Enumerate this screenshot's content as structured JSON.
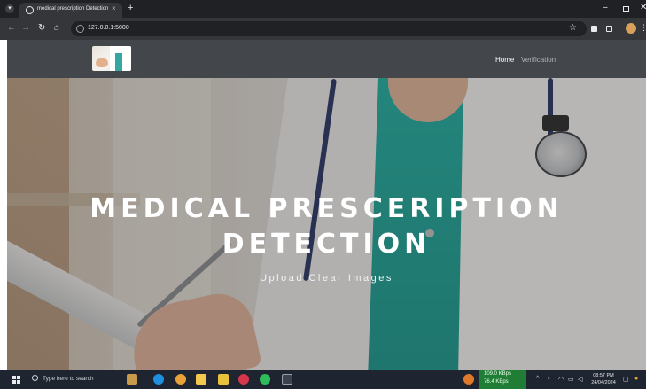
{
  "browser": {
    "tab_title": "medical prescription Detection",
    "tab_close": "×",
    "new_tab": "+",
    "url": "127.0.0.1:5000",
    "back": "←",
    "forward": "→",
    "reload": "↻",
    "home": "⌂",
    "star": "☆",
    "menu": "⋮",
    "minimize": "–",
    "close": "✕"
  },
  "site": {
    "nav": {
      "home": "Home",
      "verification": "Verification"
    },
    "hero": {
      "title_line1": "MEDICAL PRESCERIPTION",
      "title_line2": "DETECTION",
      "subtitle": "Upload Clear Images"
    }
  },
  "taskbar": {
    "search_placeholder": "Type here to search",
    "net_down": "109.0 KBps",
    "net_up": "76.4 KBps",
    "time": "08:57 PM",
    "date": "24/04/2024",
    "tray_arrow": "^"
  }
}
